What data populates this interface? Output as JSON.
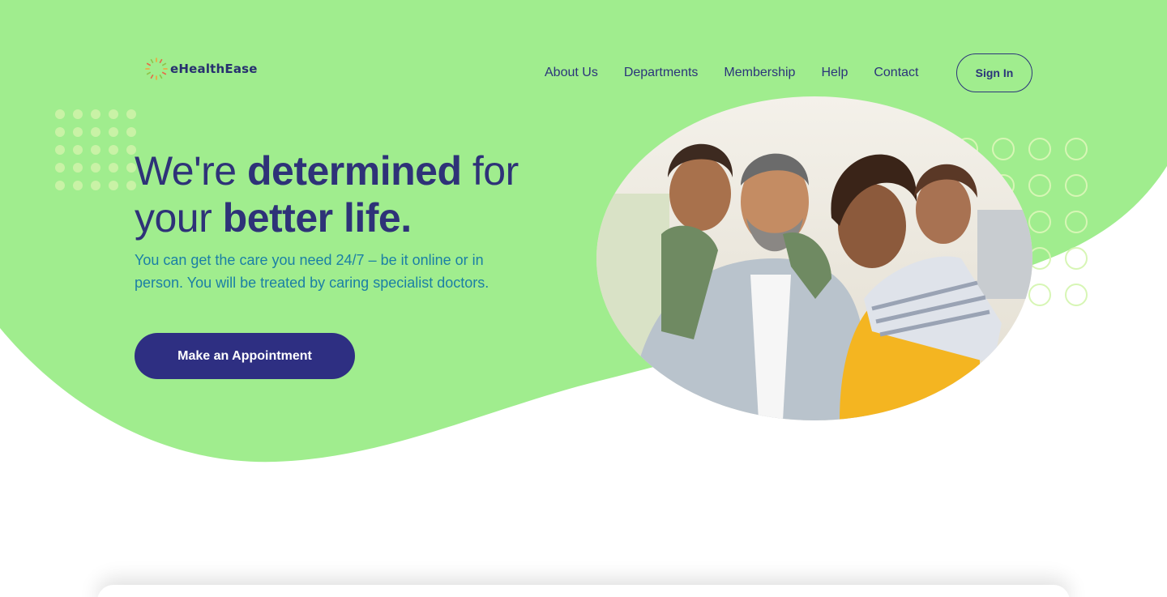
{
  "brand": {
    "name": "eHealthEase"
  },
  "nav": {
    "links": [
      "About Us",
      "Departments",
      "Membership",
      "Help",
      "Contact"
    ],
    "sign_in_label": "Sign In"
  },
  "hero": {
    "headline": {
      "part1": "We're ",
      "bold1": "determined",
      "part2": " for",
      "part3": "your ",
      "bold2": "better life."
    },
    "subtext": "You can get the care you need 24/7 – be it online or in person. You will be treated by caring specialist doctors.",
    "cta_label": "Make an Appointment",
    "image": "smiling-family-photo"
  },
  "colors": {
    "hero_bg": "#a0ed8e",
    "primary": "#2e2f82",
    "subtext": "#1b7fa5",
    "dots": "#c8f5a8"
  },
  "icons": [
    "logo-sunburst-icon"
  ]
}
